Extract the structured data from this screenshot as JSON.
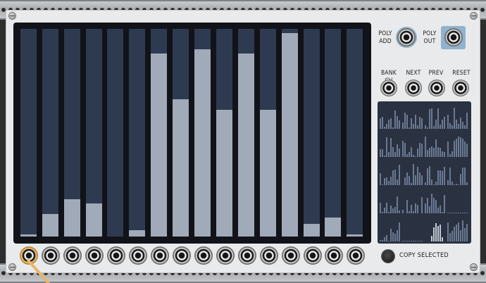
{
  "module": {
    "labels": {
      "poly_add": "POLY\nADD",
      "poly_out": "POLY\nOUT",
      "bank_cv": "BANK CV",
      "next": "NEXT",
      "prev": "PREV",
      "reset": "RESET",
      "copy_selected": "COPY SELECTED"
    },
    "colors": {
      "bar_empty": "#2e3a50",
      "bar_fill": "#a0aab9",
      "display_bg": "#111318",
      "highlight": "#8fb2cf",
      "cable": "#e6b66a"
    },
    "sliders": [
      0.01,
      0.11,
      0.18,
      0.16,
      0.0,
      0.03,
      0.88,
      0.66,
      0.9,
      0.61,
      0.88,
      0.61,
      0.98,
      0.06,
      0.09,
      0.01
    ],
    "selected_output_index": 0,
    "bank_preview": {
      "rows": 5,
      "cols": 4,
      "selected_row": 4,
      "selected_col": 2
    }
  }
}
